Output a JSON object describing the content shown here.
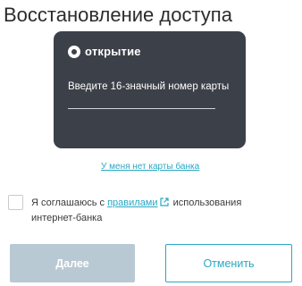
{
  "page": {
    "title": "Восстановление доступа"
  },
  "card": {
    "brand": "открытие",
    "brand_icon": "bank-logo-icon",
    "input_label": "Введите 16-значный номер карты",
    "input_value": "",
    "background": "#3c4048"
  },
  "no_card_link": "У меня нет карты банка",
  "consent": {
    "checked": false,
    "text_before": "Я соглашаюсь с",
    "link_text": "правилами",
    "link_icon": "external-link-icon",
    "text_after": "использования интернет-банка"
  },
  "buttons": {
    "next_label": "Далее",
    "next_disabled": true,
    "cancel_label": "Отменить"
  },
  "colors": {
    "accent": "#2aa8c3",
    "disabled": "#b9c9d4"
  }
}
